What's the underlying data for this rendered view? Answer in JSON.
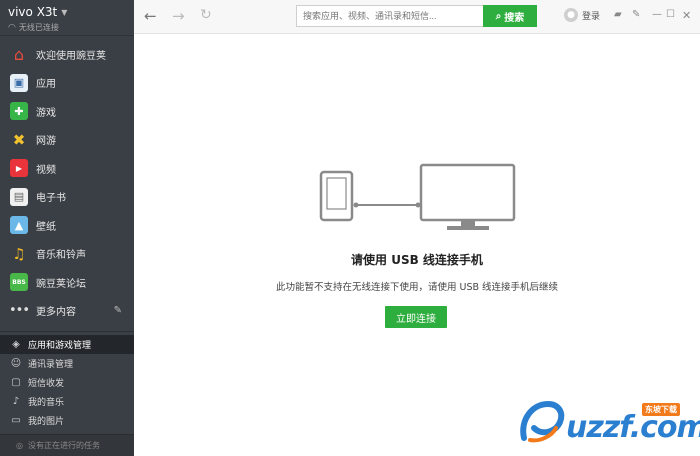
{
  "device": {
    "name": "vivo X3t",
    "status": "无线已连接"
  },
  "sidebar": {
    "items": [
      {
        "label": "欢迎使用豌豆荚",
        "icon": "home-icon"
      },
      {
        "label": "应用",
        "icon": "app-icon"
      },
      {
        "label": "游戏",
        "icon": "gamepad-icon"
      },
      {
        "label": "网游",
        "icon": "tools-icon"
      },
      {
        "label": "视频",
        "icon": "video-icon"
      },
      {
        "label": "电子书",
        "icon": "book-icon"
      },
      {
        "label": "壁纸",
        "icon": "wallpaper-icon"
      },
      {
        "label": "音乐和铃声",
        "icon": "music-icon"
      },
      {
        "label": "豌豆荚论坛",
        "icon": "bbs-icon"
      },
      {
        "label": "更多内容",
        "icon": "more-icon"
      }
    ],
    "bbs_badge": "BBS",
    "management": [
      {
        "label": "应用和游戏管理",
        "icon": "cube-icon",
        "active": true
      },
      {
        "label": "通讯录管理",
        "icon": "contact-icon"
      },
      {
        "label": "短信收发",
        "icon": "message-icon"
      },
      {
        "label": "我的音乐",
        "icon": "music-note-icon"
      },
      {
        "label": "我的图片",
        "icon": "picture-icon"
      }
    ],
    "task_status": "没有正在进行的任务"
  },
  "toolbar": {
    "search_placeholder": "搜索应用、视频、通讯录和短信...",
    "search_label": "搜索",
    "login_label": "登录"
  },
  "main": {
    "headline": "请使用 USB 线连接手机",
    "description": "此功能暂不支持在无线连接下使用，请使用 USB 线连接手机后继续",
    "connect_label": "立即连接"
  },
  "watermark": {
    "text": "uzzf.com",
    "badge": "东坡下载"
  },
  "colors": {
    "accent_green": "#2eae3e",
    "sidebar_bg": "#3a3f45",
    "watermark_blue": "#2a7fd0"
  }
}
